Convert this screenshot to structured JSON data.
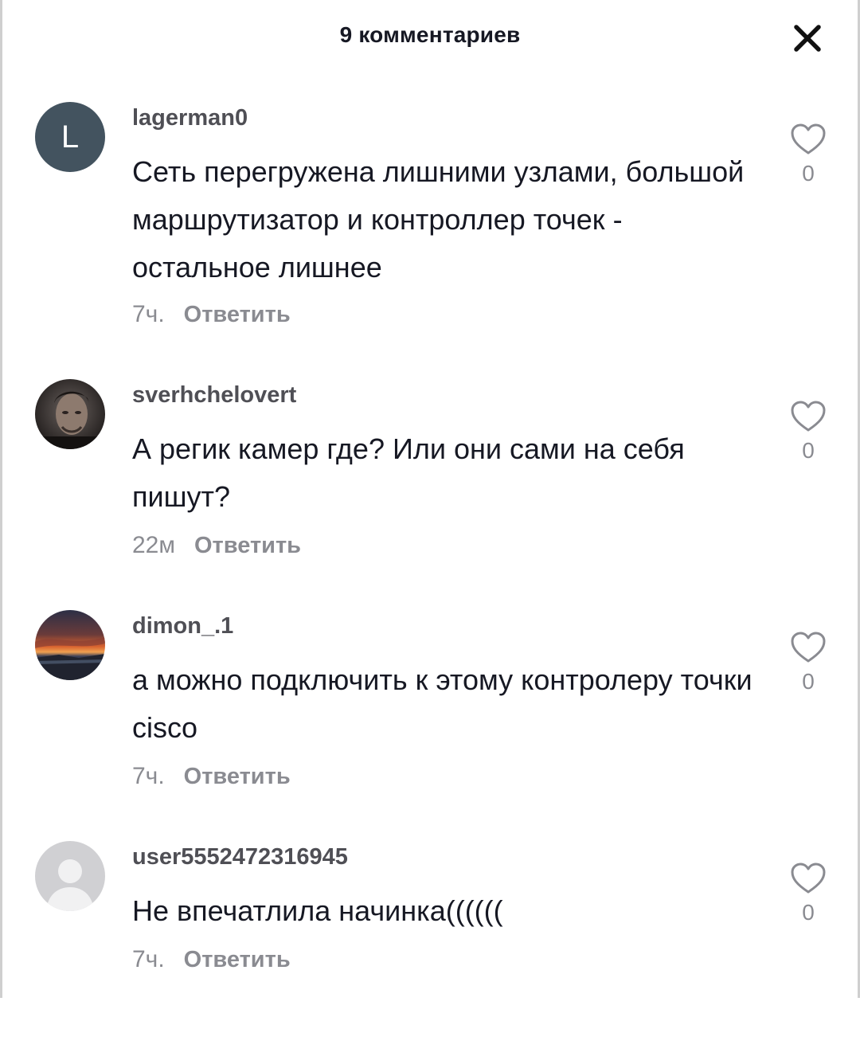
{
  "header": {
    "title": "9 комментариев",
    "close_icon": "close-icon"
  },
  "comments": [
    {
      "username": "lagerman0",
      "avatar_type": "letter",
      "avatar_letter": "L",
      "avatar_color": "#43535f",
      "text": "Сеть перегружена лишними узлами, большой маршрутизатор и контроллер точек - остальное лишнее",
      "time": "7ч.",
      "reply_label": "Ответить",
      "likes": "0"
    },
    {
      "username": "sverhchelovert",
      "avatar_type": "photo",
      "text": "А регик камер где? Или они сами на себя пишут?",
      "time": "22м",
      "reply_label": "Ответить",
      "likes": "0"
    },
    {
      "username": "dimon_.1",
      "avatar_type": "photo",
      "text": "а можно подключить к этому контролеру точки cisco",
      "time": "7ч.",
      "reply_label": "Ответить",
      "likes": "0"
    },
    {
      "username": "user5552472316945",
      "avatar_type": "default",
      "text": "Не впечатлила начинка((((((",
      "time": "7ч.",
      "reply_label": "Ответить",
      "likes": "0"
    }
  ],
  "colors": {
    "text_primary": "#161823",
    "text_secondary": "#8a8b91",
    "username": "#4f4f55"
  }
}
